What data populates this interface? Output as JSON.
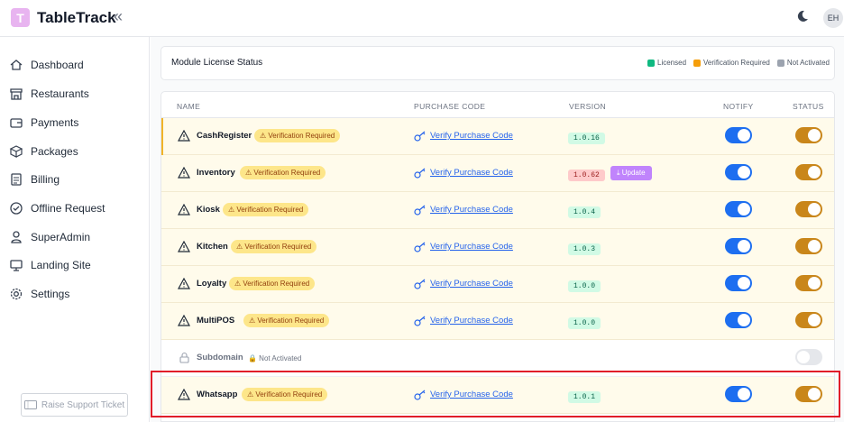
{
  "app": {
    "logo_letter": "T",
    "title": "TableTrack",
    "collapse_symbol": "«",
    "avatar_initials": "EH",
    "theme_icon": "moon-icon"
  },
  "sidebar": {
    "items": [
      {
        "label": "Dashboard",
        "icon": "home-icon"
      },
      {
        "label": "Restaurants",
        "icon": "store-icon"
      },
      {
        "label": "Payments",
        "icon": "wallet-icon"
      },
      {
        "label": "Packages",
        "icon": "package-icon"
      },
      {
        "label": "Billing",
        "icon": "document-icon"
      },
      {
        "label": "Offline Request",
        "icon": "check-circle-icon"
      },
      {
        "label": "SuperAdmin",
        "icon": "user-icon"
      },
      {
        "label": "Landing Site",
        "icon": "monitor-icon"
      },
      {
        "label": "Settings",
        "icon": "gear-icon"
      }
    ],
    "support_label": "Raise Support Ticket"
  },
  "license_status": {
    "title": "Module License Status",
    "legend": [
      {
        "label": "Licensed",
        "color": "#10b981"
      },
      {
        "label": "Verification Required",
        "color": "#f59e0b"
      },
      {
        "label": "Not Activated",
        "color": "#9ca3af"
      }
    ]
  },
  "table": {
    "headers": {
      "name": "NAME",
      "purchase_code": "PURCHASE CODE",
      "version": "VERSION",
      "notify": "NOTIFY",
      "status": "STATUS"
    },
    "rows": [
      {
        "name": "CashRegister",
        "badge": "⚠ Verification Required",
        "link": "Verify Purchase Code",
        "version": "1.0.16",
        "notify": true,
        "status": true
      },
      {
        "name": "Inventory",
        "badge": "⚠ Verification Required",
        "link": "Verify Purchase Code",
        "version": "1.0.62",
        "update_label": "⤓ Update",
        "notify": true,
        "status": true
      },
      {
        "name": "Kiosk",
        "badge": "⚠ Verification Required",
        "link": "Verify Purchase Code",
        "version": "1.0.4",
        "notify": true,
        "status": true
      },
      {
        "name": "Kitchen",
        "badge": "⚠ Verification Required",
        "link": "Verify Purchase Code",
        "version": "1.0.3",
        "notify": true,
        "status": true
      },
      {
        "name": "Loyalty",
        "badge": "⚠ Verification Required",
        "link": "Verify Purchase Code",
        "version": "1.0.0",
        "notify": true,
        "status": true
      },
      {
        "name": "MultiPOS",
        "badge": "⚠ Verification Required",
        "link": "Verify Purchase Code",
        "version": "1.0.0",
        "notify": true,
        "status": true
      },
      {
        "name": "Subdomain",
        "badge": "🔒 Not Activated",
        "status": false
      },
      {
        "name": "Whatsapp",
        "badge": "⚠ Verification Required",
        "link": "Verify Purchase Code",
        "version": "1.0.1",
        "notify": true,
        "status": true
      }
    ]
  },
  "colors": {
    "notify_on": "#1d6ef0",
    "status_on": "#c9861a",
    "toggle_off": "#e5e7eb",
    "highlight": "#e11d2a"
  }
}
